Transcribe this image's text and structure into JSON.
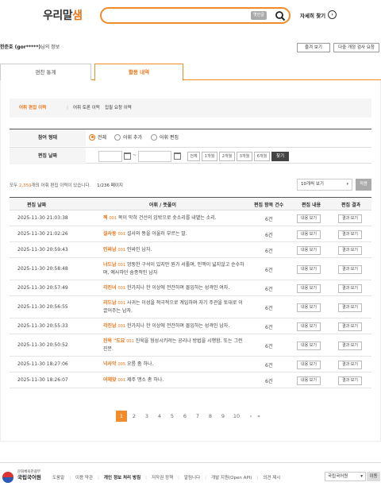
{
  "header": {
    "logo_text": "우리말",
    "logo_accent": "샘",
    "search_tag": "옛한글",
    "detail_search": "자세히 찾기"
  },
  "user": {
    "name": "한준호 (gor*****)",
    "suffix": "님의 정보",
    "btn_favorites": "즐겨 보기",
    "btn_report": "다중 개정 검사 요청"
  },
  "tabs": [
    "편찬 통계",
    "활동 내역"
  ],
  "subnav": [
    "어휘 편집 이력",
    "어휘 토론 이력",
    "집필 요청 이력"
  ],
  "filter": {
    "type_label": "참여 형태",
    "type_options": [
      "전체",
      "어휘 추가",
      "어휘 편집"
    ],
    "date_label": "편집 날짜",
    "tilde": "~",
    "ranges": [
      "전체",
      "1개월",
      "2개월",
      "3개월",
      "6개월"
    ],
    "find": "찾기"
  },
  "summary": {
    "prefix": "모두 ",
    "count": "2,359",
    "suffix": "개의 어휘 편집 이력이 있습니다.",
    "page": "1/236 페이지"
  },
  "page_size": "10개씩 보기",
  "apply": "적용",
  "table": {
    "headers": [
      "편집 날짜",
      "어휘 / 뜻풀이",
      "편집 항목 건수",
      "편집 내용",
      "편집 결과"
    ],
    "view_label": "내용 보기",
    "result_label": "결과 보기",
    "rows": [
      {
        "date": "2025-11-30 21:03:38",
        "word": "젝",
        "num": "001",
        "def": "목이 막혀 건선의 입밖으로 솟소리를 내뱉는 소리.",
        "count": "6건"
      },
      {
        "date": "2025-11-30 21:02:26",
        "word": "설사동",
        "num": "001",
        "def": "설사와 똥을 아울러 부르는 말.",
        "count": "6건"
      },
      {
        "date": "2025-11-30 20:59:43",
        "word": "인싸남",
        "num": "001",
        "def": "인싸인 남자.",
        "count": "6건"
      },
      {
        "date": "2025-11-30 20:58:48",
        "word": "너드남",
        "num": "001",
        "def": "엉뚱한 구석이 있지만 뭔가 서툴며, 인맥이 넓지않고 순수하며, 예사하던 숨종적인 남자",
        "count": "6건"
      },
      {
        "date": "2025-11-30 20:57:49",
        "word": "각진녀",
        "num": "001",
        "def": "한가지나 한 이상에 전잔하며 몰입하는 성격인 여자.",
        "count": "6건"
      },
      {
        "date": "2025-11-30 20:56:55",
        "word": "리드남",
        "num": "001",
        "def": "사귀는 이성을 적극적으로 계입하며 자기 주관을 토대로 이끌어주는 남자.",
        "count": "6건"
      },
      {
        "date": "2025-11-30 20:55:33",
        "word": "각진남",
        "num": "001",
        "def": "한가지나 한 이상에 전잔하며 몰입하는 성격인 남자.",
        "count": "6건"
      },
      {
        "date": "2025-11-30 20:50:52",
        "word": "진욱 \"도묘",
        "num": "001",
        "def": "진욱을 형성시키려는 공리나 방법을 시행함. 또는 그런 진분.",
        "count": "6건"
      },
      {
        "date": "2025-11-30 18:27:06",
        "word": "넉사악",
        "num": "005",
        "def": "오름 좀 하나.",
        "count": "6건"
      },
      {
        "date": "2025-11-30 18:26:07",
        "word": "어체맞",
        "num": "001",
        "def": "제주 맹소 총 하나.",
        "count": "6건"
      }
    ]
  },
  "pagination": [
    "1",
    "2",
    "3",
    "4",
    "5",
    "6",
    "7",
    "8",
    "9",
    "10",
    "›",
    "»"
  ],
  "footer": {
    "org_small": "문화체육관광부",
    "org_name": "국립국어원",
    "links": [
      "도움말",
      "이용 약관",
      "개인 정보 처리 방침",
      "저작권 정책",
      "알림니다",
      "개발 지원(Open API)",
      "의견 제시"
    ],
    "select": "국립국어원",
    "go": "이동"
  },
  "colors": {
    "accent": "#f08c2a",
    "accent_text": "#e8761a"
  }
}
